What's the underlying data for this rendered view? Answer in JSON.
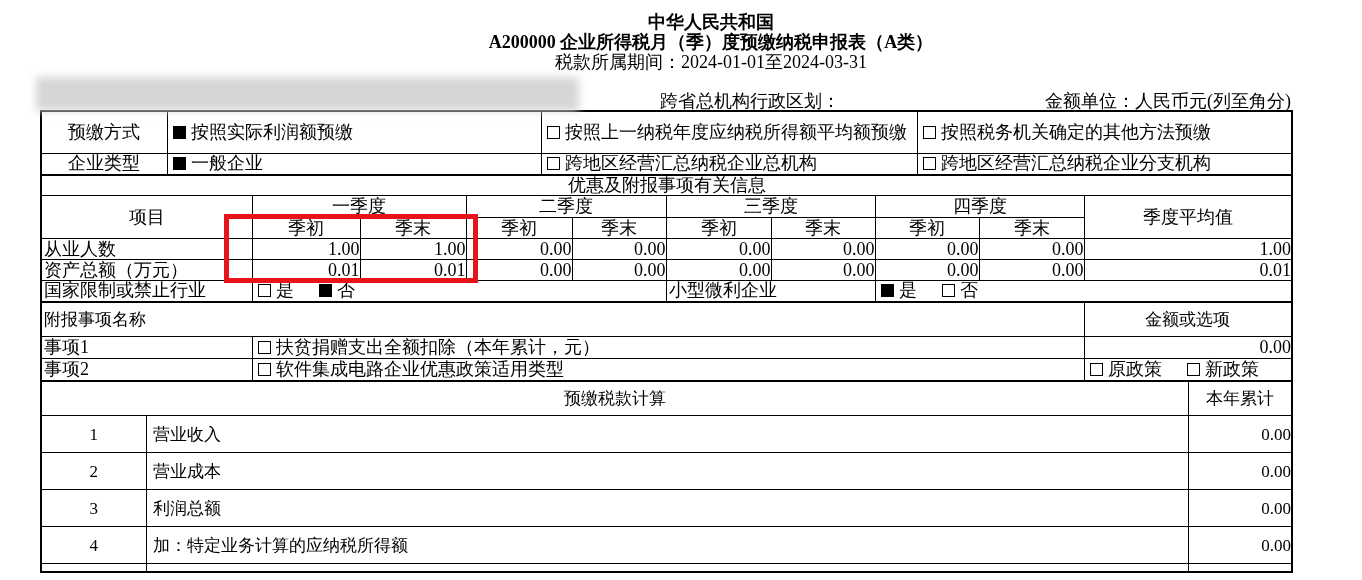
{
  "header": {
    "country": "中华人民共和国",
    "form_title": "A200000 企业所得税月（季）度预缴纳税申报表（A类）",
    "period": "税款所属期间：2024-01-01至2024-03-31",
    "region_label": "跨省总机构行政区划：",
    "unit": "金额单位：人民币元(列至角分)"
  },
  "basic": [
    {
      "label": "预缴方式",
      "options": [
        {
          "label": "按照实际利润额预缴",
          "checked": true
        },
        {
          "label": "按照上一纳税年度应纳税所得额平均额预缴",
          "checked": false
        },
        {
          "label": "按照税务机关确定的其他方法预缴",
          "checked": false
        }
      ]
    },
    {
      "label": "企业类型",
      "options": [
        {
          "label": "一般企业",
          "checked": true
        },
        {
          "label": "跨地区经营汇总纳税企业总机构",
          "checked": false
        },
        {
          "label": "跨地区经营汇总纳税企业分支机构",
          "checked": false
        }
      ]
    }
  ],
  "section_title": "优惠及附报事项有关信息",
  "quarter_table": {
    "item_header": "项目",
    "average_header": "季度平均值",
    "quarters": [
      {
        "name": "一季度",
        "columns": [
          "季初",
          "季末"
        ]
      },
      {
        "name": "二季度",
        "columns": [
          "季初",
          "季末"
        ]
      },
      {
        "name": "三季度",
        "columns": [
          "季初",
          "季末"
        ]
      },
      {
        "name": "四季度",
        "columns": [
          "季初",
          "季末"
        ]
      }
    ],
    "rows": [
      {
        "label": "从业人数",
        "values": [
          "1.00",
          "1.00",
          "0.00",
          "0.00",
          "0.00",
          "0.00",
          "0.00",
          "0.00"
        ],
        "average": "1.00"
      },
      {
        "label": "资产总额（万元）",
        "values": [
          "0.01",
          "0.01",
          "0.00",
          "0.00",
          "0.00",
          "0.00",
          "0.00",
          "0.00"
        ],
        "average": "0.01"
      }
    ]
  },
  "flags": [
    {
      "label": "国家限制或禁止行业",
      "options": [
        {
          "label": "是",
          "checked": false
        },
        {
          "label": "否",
          "checked": true
        }
      ]
    },
    {
      "label": "小型微利企业",
      "options": [
        {
          "label": "是",
          "checked": true
        },
        {
          "label": "否",
          "checked": false
        }
      ]
    }
  ],
  "supplement": {
    "title": "附报事项名称",
    "value_header": "金额或选项",
    "items": [
      {
        "kind": "amount",
        "name": "事项1",
        "description": "扶贫捐赠支出全额扣除（本年累计，元）",
        "checked": false,
        "value": "0.00"
      },
      {
        "kind": "choice",
        "name": "事项2",
        "description": "软件集成电路企业优惠政策适用类型",
        "checked": false,
        "options": [
          {
            "label": "原政策",
            "checked": false
          },
          {
            "label": "新政策",
            "checked": false
          }
        ]
      }
    ]
  },
  "calculation": {
    "title": "预缴税款计算",
    "total_header": "本年累计",
    "rows": [
      {
        "number": "1",
        "label": "营业收入",
        "value": "0.00"
      },
      {
        "number": "2",
        "label": "营业成本",
        "value": "0.00"
      },
      {
        "number": "3",
        "label": "利润总额",
        "value": "0.00"
      },
      {
        "number": "4",
        "label": "加：特定业务计算的应纳税所得额",
        "value": "0.00"
      }
    ]
  }
}
